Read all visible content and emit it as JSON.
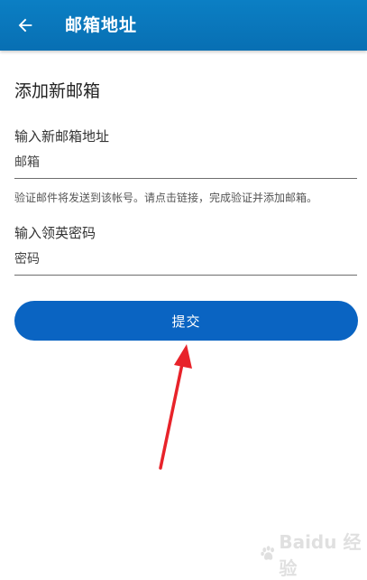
{
  "app_bar": {
    "title": "邮箱地址",
    "back_icon": "arrow-left-icon",
    "background_color": "#0b7fc4"
  },
  "form": {
    "section_title": "添加新邮箱",
    "email_label": "输入新邮箱地址",
    "email_placeholder": "邮箱",
    "email_value": "",
    "hint": "验证邮件将发送到该帐号。请点击链接，完成验证并添加邮箱。",
    "password_label": "输入领英密码",
    "password_placeholder": "密码",
    "password_value": ""
  },
  "submit": {
    "label": "提交",
    "color": "#0a64c2"
  },
  "annotation": {
    "arrow_color": "#e8232a"
  },
  "watermark": {
    "text": "Baidu 经验"
  }
}
